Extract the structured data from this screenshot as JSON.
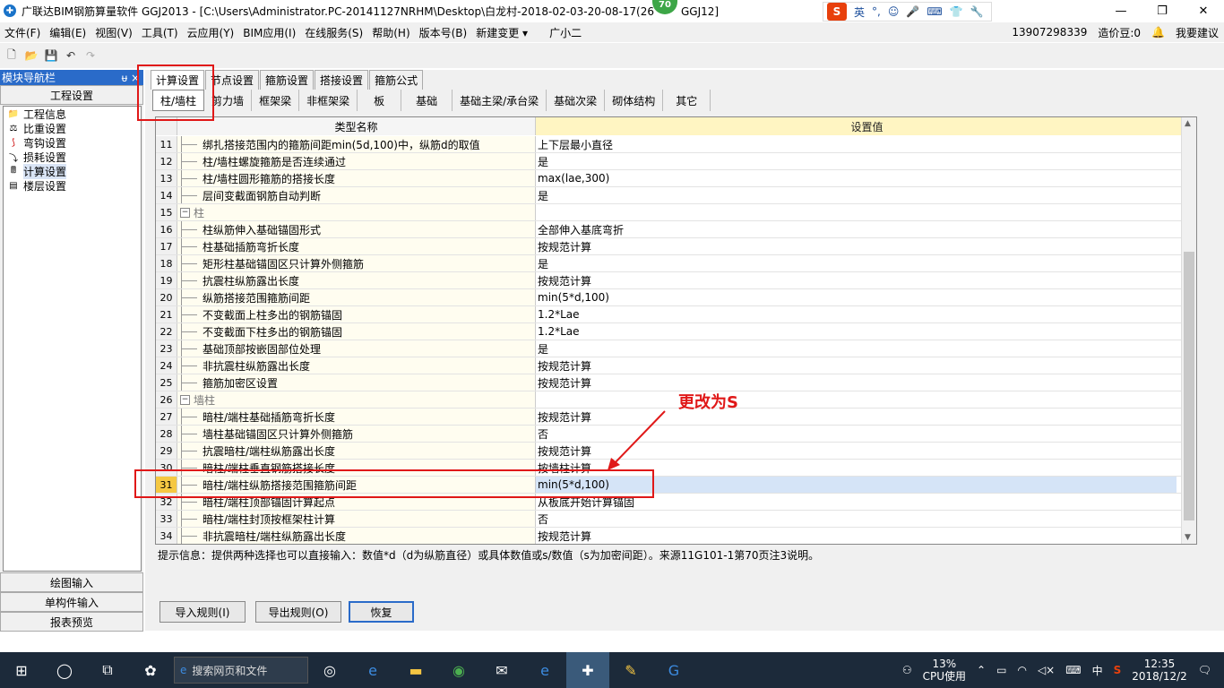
{
  "titlebar": {
    "title": "广联达BIM钢筋算量软件 GGJ2013 - [C:\\Users\\Administrator.PC-20141127NRHM\\Desktop\\白龙村-2018-02-03-20-08-17(26",
    "title_tail": "GGJ12]",
    "badge": "70",
    "ime_lang": "英",
    "restore": "❐",
    "close": "✕",
    "minimize": "—"
  },
  "menu": {
    "items": [
      "文件(F)",
      "编辑(E)",
      "视图(V)",
      "工具(T)",
      "云应用(Y)",
      "BIM应用(I)",
      "在线服务(S)",
      "帮助(H)",
      "版本号(B)",
      "新建变更 ▾",
      "广小二"
    ],
    "phone": "13907298339",
    "coins": "造价豆:0",
    "suggest": "我要建议"
  },
  "left": {
    "header": "模块导航栏",
    "pin": "ᵾ  ×",
    "section": "工程设置",
    "items": [
      {
        "label": "工程信息",
        "icon": "info-icon"
      },
      {
        "label": "比重设置",
        "icon": "weight-icon"
      },
      {
        "label": "弯钩设置",
        "icon": "hook-icon"
      },
      {
        "label": "损耗设置",
        "icon": "loss-icon"
      },
      {
        "label": "计算设置",
        "icon": "calc-icon"
      },
      {
        "label": "楼层设置",
        "icon": "floor-icon"
      }
    ],
    "bottom": [
      "绘图输入",
      "单构件输入",
      "报表预览"
    ]
  },
  "tabs": {
    "top": [
      "计算设置",
      "节点设置",
      "箍筋设置",
      "搭接设置",
      "箍筋公式"
    ],
    "sub": [
      "柱/墙柱",
      "剪力墙",
      "框架梁",
      "非框架梁",
      "板",
      "基础",
      "基础主梁/承台梁",
      "基础次梁",
      "砌体结构",
      "其它"
    ]
  },
  "grid": {
    "col_name": "类型名称",
    "col_value": "设置值",
    "rows": [
      {
        "n": "11",
        "name": "绑扎搭接范围内的箍筋间距min(5d,100)中，纵筋d的取值",
        "value": "上下层最小直径"
      },
      {
        "n": "12",
        "name": "柱/墙柱螺旋箍筋是否连续通过",
        "value": "是"
      },
      {
        "n": "13",
        "name": "柱/墙柱圆形箍筋的搭接长度",
        "value": "max(lae,300)"
      },
      {
        "n": "14",
        "name": "层间变截面钢筋自动判断",
        "value": "是"
      },
      {
        "n": "15",
        "name": "柱",
        "value": "",
        "group": true
      },
      {
        "n": "16",
        "name": "柱纵筋伸入基础锚固形式",
        "value": "全部伸入基底弯折"
      },
      {
        "n": "17",
        "name": "柱基础插筋弯折长度",
        "value": "按规范计算"
      },
      {
        "n": "18",
        "name": "矩形柱基础锚固区只计算外侧箍筋",
        "value": "是"
      },
      {
        "n": "19",
        "name": "抗震柱纵筋露出长度",
        "value": "按规范计算"
      },
      {
        "n": "20",
        "name": "纵筋搭接范围箍筋间距",
        "value": "min(5*d,100)"
      },
      {
        "n": "21",
        "name": "不变截面上柱多出的钢筋锚固",
        "value": "1.2*Lae"
      },
      {
        "n": "22",
        "name": "不变截面下柱多出的钢筋锚固",
        "value": "1.2*Lae"
      },
      {
        "n": "23",
        "name": "基础顶部按嵌固部位处理",
        "value": "是"
      },
      {
        "n": "24",
        "name": "非抗震柱纵筋露出长度",
        "value": "按规范计算"
      },
      {
        "n": "25",
        "name": "箍筋加密区设置",
        "value": "按规范计算"
      },
      {
        "n": "26",
        "name": "墙柱",
        "value": "",
        "group": true
      },
      {
        "n": "27",
        "name": "暗柱/端柱基础插筋弯折长度",
        "value": "按规范计算"
      },
      {
        "n": "28",
        "name": "墙柱基础锚固区只计算外侧箍筋",
        "value": "否"
      },
      {
        "n": "29",
        "name": "抗震暗柱/端柱纵筋露出长度",
        "value": "按规范计算"
      },
      {
        "n": "30",
        "name": "暗柱/端柱垂直钢筋搭接长度",
        "value": "按墙柱计算"
      },
      {
        "n": "31",
        "name": "暗柱/端柱纵筋搭接范围箍筋间距",
        "value": "min(5*d,100)",
        "selected": true
      },
      {
        "n": "32",
        "name": "暗柱/端柱顶部锚固计算起点",
        "value": "从板底开始计算锚固"
      },
      {
        "n": "33",
        "name": "暗柱/端柱封顶按框架柱计算",
        "value": "否"
      },
      {
        "n": "34",
        "name": "非抗震暗柱/端柱纵筋露出长度",
        "value": "按规范计算"
      }
    ]
  },
  "hint": "提示信息：提供两种选择也可以直接输入：数值*d（d为纵筋直径）或具体数值或s/数值（s为加密间距）。来源11G101-1第70页注3说明。",
  "buttons": {
    "import": "导入规则(I)",
    "export": "导出规则(O)",
    "restore": "恢复"
  },
  "annotation": {
    "text": "更改为S",
    "color": "#e01818"
  },
  "taskbar": {
    "search": "搜索网页和文件",
    "cpu": "13%",
    "cpu_label": "CPU使用",
    "time": "12:35",
    "date": "2018/12/2",
    "lang": "中"
  }
}
